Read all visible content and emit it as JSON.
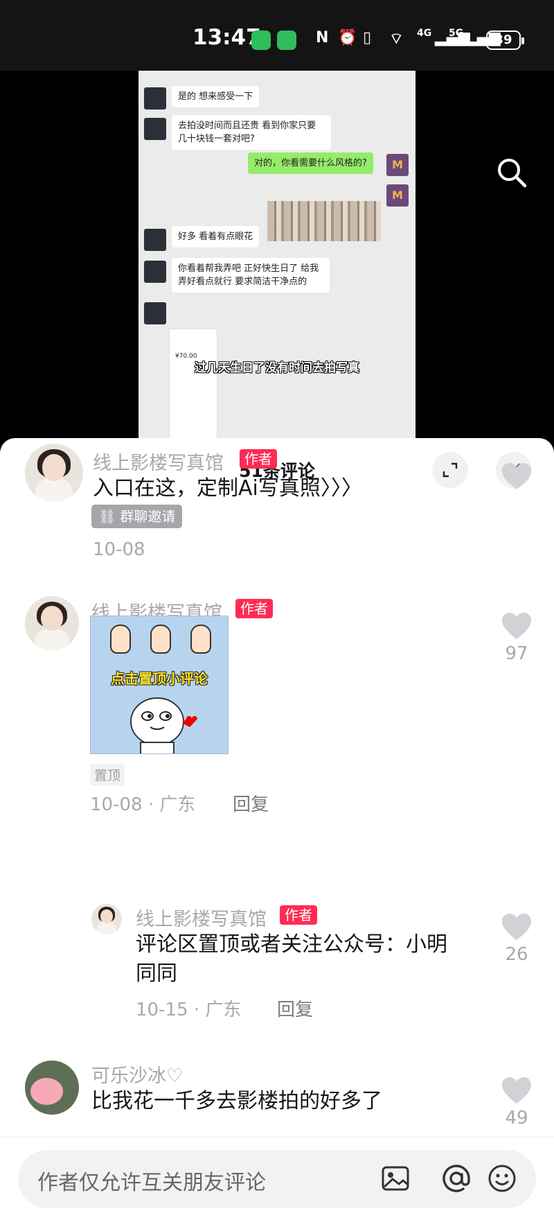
{
  "status_bar": {
    "time": "13:47",
    "network_1": "4G",
    "network_2": "5G",
    "battery": "39"
  },
  "video": {
    "chat_screenshot": {
      "messages": [
        {
          "side": "left",
          "text": "是的 想来感受一下"
        },
        {
          "side": "left",
          "text": "去拍没时间而且还贵 看到你家只要几十块钱一套对吧?"
        },
        {
          "side": "right",
          "text": "对的，你看需要什么风格的?"
        },
        {
          "side": "left",
          "text": "好多 看着有点眼花"
        },
        {
          "side": "left",
          "text": "你看着帮我弄吧 正好快生日了 给我弄好看点就行 要求简洁干净点的"
        }
      ],
      "right_avatar_letter": "M",
      "price": "¥70.00"
    },
    "caption": "过几天生日了没有时间去拍写真",
    "search_icon": "search-icon"
  },
  "comments_panel": {
    "title": "51条评论",
    "expand_icon": "expand-icon",
    "close_icon": "close-icon",
    "comments": [
      {
        "user": "线上影楼写真馆",
        "tag": "作者",
        "text": "入口在这，定制Ai写真照〉〉〉",
        "chip": "群聊邀请",
        "date": "10-08",
        "likes": ""
      },
      {
        "user": "线上影楼写真馆",
        "tag": "作者",
        "sticker_text": "点击置顶小评论",
        "pinned": "置顶",
        "date": "10-08 · 广东",
        "reply": "回复",
        "likes": "97"
      },
      {
        "user": "线上影楼写真馆",
        "tag": "作者",
        "text_line1": "评论区置顶或者关注公众号：小明",
        "text_line2": "同同",
        "date": "10-15 · 广东",
        "reply": "回复",
        "likes": "26"
      },
      {
        "user": "可乐沙冰♡",
        "text": "比我花一千多去影楼拍的好多了",
        "likes": "49"
      }
    ]
  },
  "input": {
    "placeholder": "作者仅允许互关朋友评论",
    "icons": [
      "image-icon",
      "mention-icon",
      "emoji-icon"
    ]
  }
}
